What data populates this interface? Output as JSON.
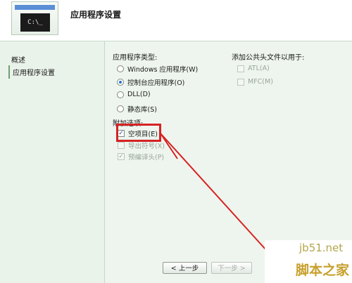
{
  "header": {
    "icon_text": "C:\\_",
    "title": "应用程序设置"
  },
  "nav": {
    "items": [
      "概述",
      "应用程序设置"
    ]
  },
  "app_type": {
    "title": "应用程序类型:",
    "options": [
      "Windows 应用程序(W)",
      "控制台应用程序(O)",
      "DLL(D)",
      "静态库(S)"
    ]
  },
  "common_headers": {
    "title": "添加公共头文件以用于:",
    "options": [
      "ATL(A)",
      "MFC(M)"
    ]
  },
  "extra": {
    "title": "附加选项:",
    "options": [
      "空项目(E)",
      "导出符号(X)",
      "预编译头(P)"
    ]
  },
  "buttons": {
    "back": "< 上一步",
    "next": "下一步 >"
  },
  "watermark": {
    "line1": "jb51.net",
    "line2": "脚本之家"
  },
  "colors": {
    "highlight": "#d62222",
    "accent": "#2b6fd0"
  }
}
